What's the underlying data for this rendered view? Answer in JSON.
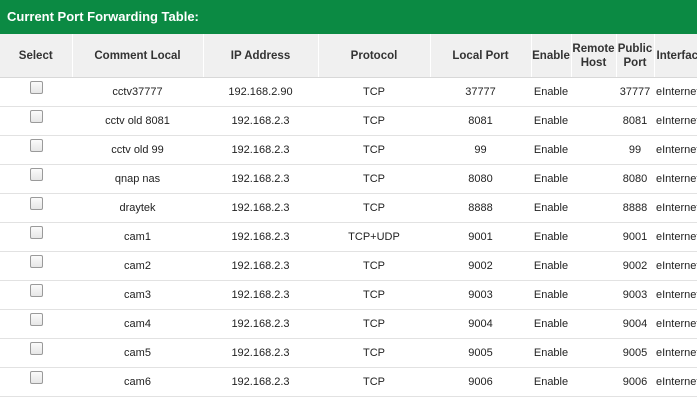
{
  "title": "Current Port Forwarding Table:",
  "columns": {
    "select": "Select",
    "comment": "Comment Local",
    "ip": "IP Address",
    "protocol": "Protocol",
    "local_port": "Local Port",
    "enable": "Enable",
    "remote_host_1": "Remote",
    "remote_host_2": "Host",
    "public_port_1": "Public",
    "public_port_2": "Port",
    "interface": "Interface"
  },
  "rows": [
    {
      "comment": "cctv37777",
      "ip": "192.168.2.90",
      "protocol": "TCP",
      "local_port": "37777",
      "enable": "Enable",
      "remote_host": "",
      "public_port": "37777",
      "interface": "eInternet"
    },
    {
      "comment": "cctv old 8081",
      "ip": "192.168.2.3",
      "protocol": "TCP",
      "local_port": "8081",
      "enable": "Enable",
      "remote_host": "",
      "public_port": "8081",
      "interface": "eInternet"
    },
    {
      "comment": "cctv old 99",
      "ip": "192.168.2.3",
      "protocol": "TCP",
      "local_port": "99",
      "enable": "Enable",
      "remote_host": "",
      "public_port": "99",
      "interface": "eInternet"
    },
    {
      "comment": "qnap nas",
      "ip": "192.168.2.3",
      "protocol": "TCP",
      "local_port": "8080",
      "enable": "Enable",
      "remote_host": "",
      "public_port": "8080",
      "interface": "eInternet"
    },
    {
      "comment": "draytek",
      "ip": "192.168.2.3",
      "protocol": "TCP",
      "local_port": "8888",
      "enable": "Enable",
      "remote_host": "",
      "public_port": "8888",
      "interface": "eInternet"
    },
    {
      "comment": "cam1",
      "ip": "192.168.2.3",
      "protocol": "TCP+UDP",
      "local_port": "9001",
      "enable": "Enable",
      "remote_host": "",
      "public_port": "9001",
      "interface": "eInternet"
    },
    {
      "comment": "cam2",
      "ip": "192.168.2.3",
      "protocol": "TCP",
      "local_port": "9002",
      "enable": "Enable",
      "remote_host": "",
      "public_port": "9002",
      "interface": "eInternet"
    },
    {
      "comment": "cam3",
      "ip": "192.168.2.3",
      "protocol": "TCP",
      "local_port": "9003",
      "enable": "Enable",
      "remote_host": "",
      "public_port": "9003",
      "interface": "eInternet"
    },
    {
      "comment": "cam4",
      "ip": "192.168.2.3",
      "protocol": "TCP",
      "local_port": "9004",
      "enable": "Enable",
      "remote_host": "",
      "public_port": "9004",
      "interface": "eInternet"
    },
    {
      "comment": "cam5",
      "ip": "192.168.2.3",
      "protocol": "TCP",
      "local_port": "9005",
      "enable": "Enable",
      "remote_host": "",
      "public_port": "9005",
      "interface": "eInternet"
    },
    {
      "comment": "cam6",
      "ip": "192.168.2.3",
      "protocol": "TCP",
      "local_port": "9006",
      "enable": "Enable",
      "remote_host": "",
      "public_port": "9006",
      "interface": "eInternet"
    }
  ],
  "colors": {
    "title_bar": "#0b8a43",
    "header_bg": "#f0f0f0"
  }
}
